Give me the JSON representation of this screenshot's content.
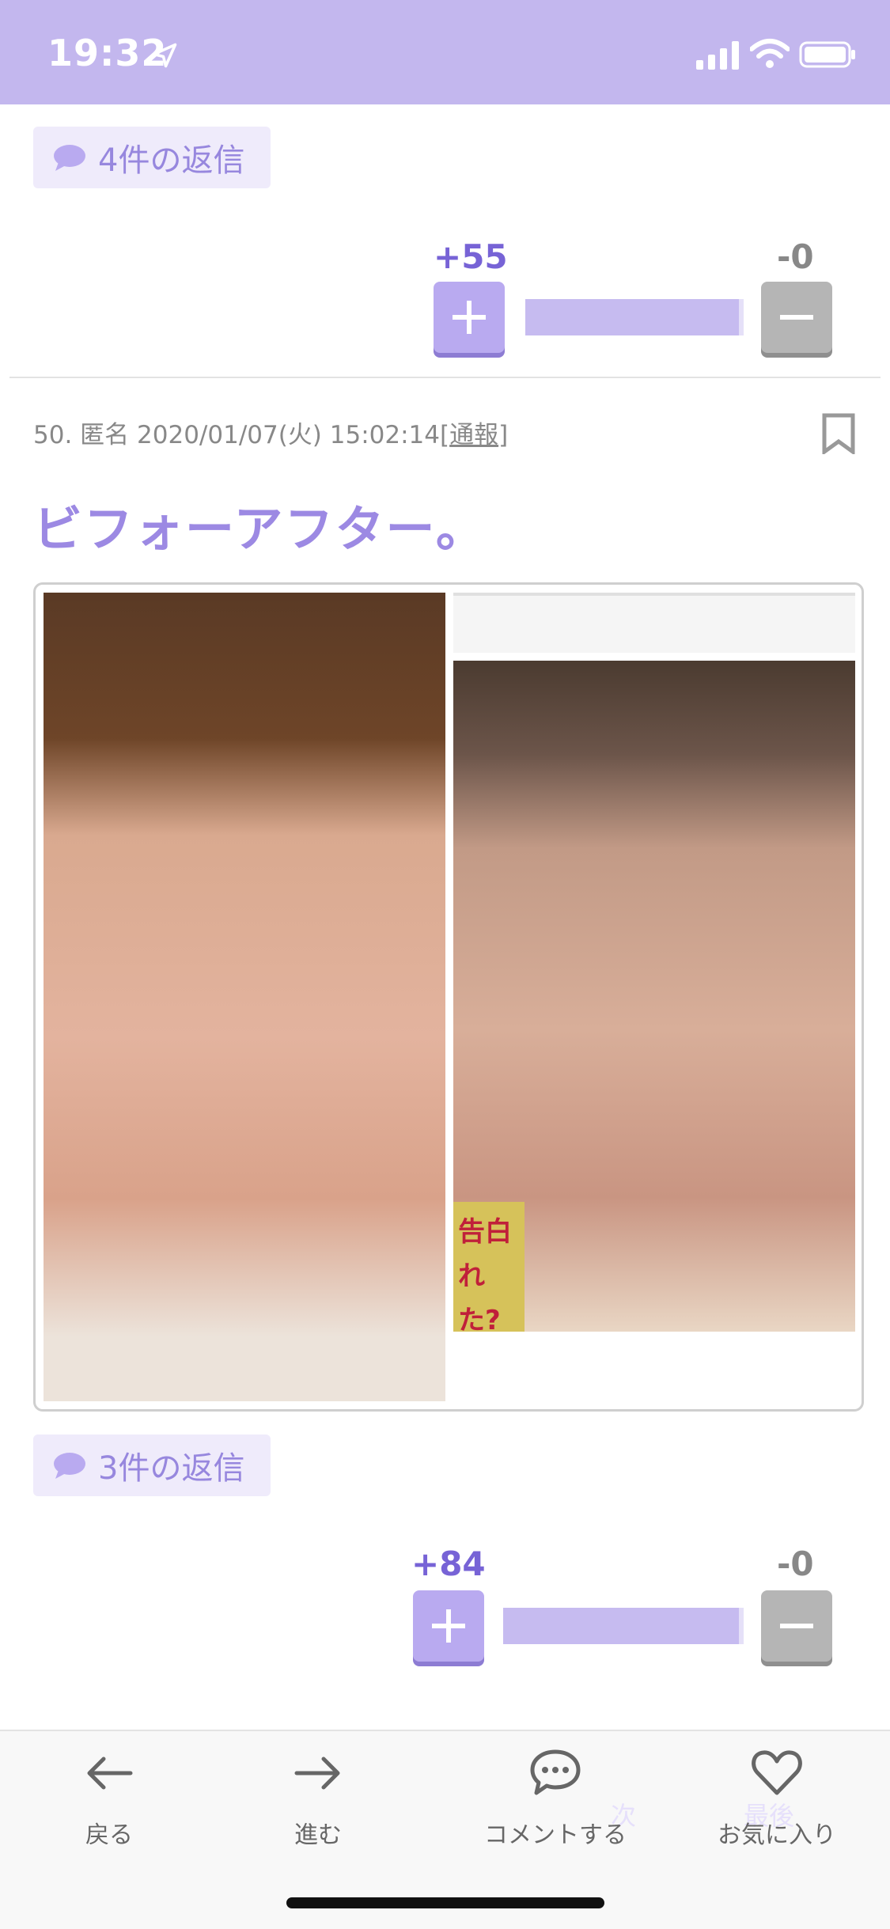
{
  "status_bar": {
    "time": "19:32"
  },
  "post_prev": {
    "replies_label": "4件の返信",
    "vote": {
      "plus": "+55",
      "minus": "-0",
      "plus_ratio": 1.0
    }
  },
  "post": {
    "number": "50.",
    "author": "匿名",
    "datetime": "2020/01/07(火) 15:02:14",
    "report_open": "[",
    "report_label": "通報",
    "report_close": "]",
    "title": "ビフォーアフター。",
    "image_text": "告白 れた?",
    "replies_label": "3件の返信",
    "vote": {
      "plus": "+84",
      "minus": "-0",
      "plus_ratio": 1.0
    }
  },
  "toolbar": {
    "back": "戻る",
    "forward": "進む",
    "comment": "コメントする",
    "favorite": "お気に入り",
    "ghost_next": "次",
    "ghost_last": "最後"
  },
  "colors": {
    "accent": "#9c89e3",
    "status_bar": "#c3b7ee",
    "vote_plus": "#7763d6"
  }
}
